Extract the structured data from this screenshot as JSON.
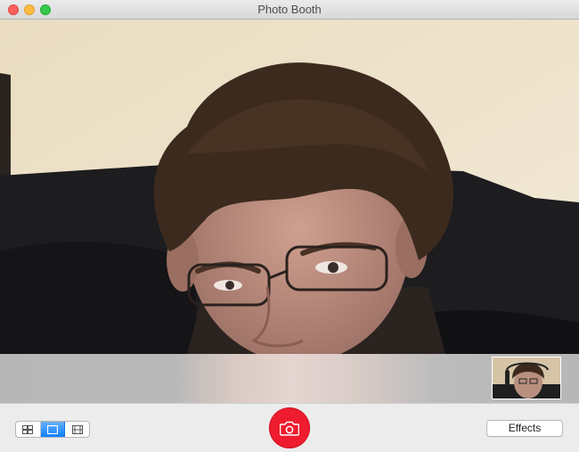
{
  "window": {
    "title": "Photo Booth"
  },
  "toolbar": {
    "layout_modes": [
      {
        "name": "four-up-icon",
        "selected": false
      },
      {
        "name": "single-photo-icon",
        "selected": true
      },
      {
        "name": "video-icon",
        "selected": false
      }
    ],
    "shutter_icon": "camera-icon",
    "effects_label": "Effects"
  },
  "colors": {
    "shutter": "#ee1c2e",
    "selected_segment": "#0d81ff",
    "close": "#fc605c",
    "minimize": "#fdbc40",
    "zoom": "#34c84a"
  }
}
